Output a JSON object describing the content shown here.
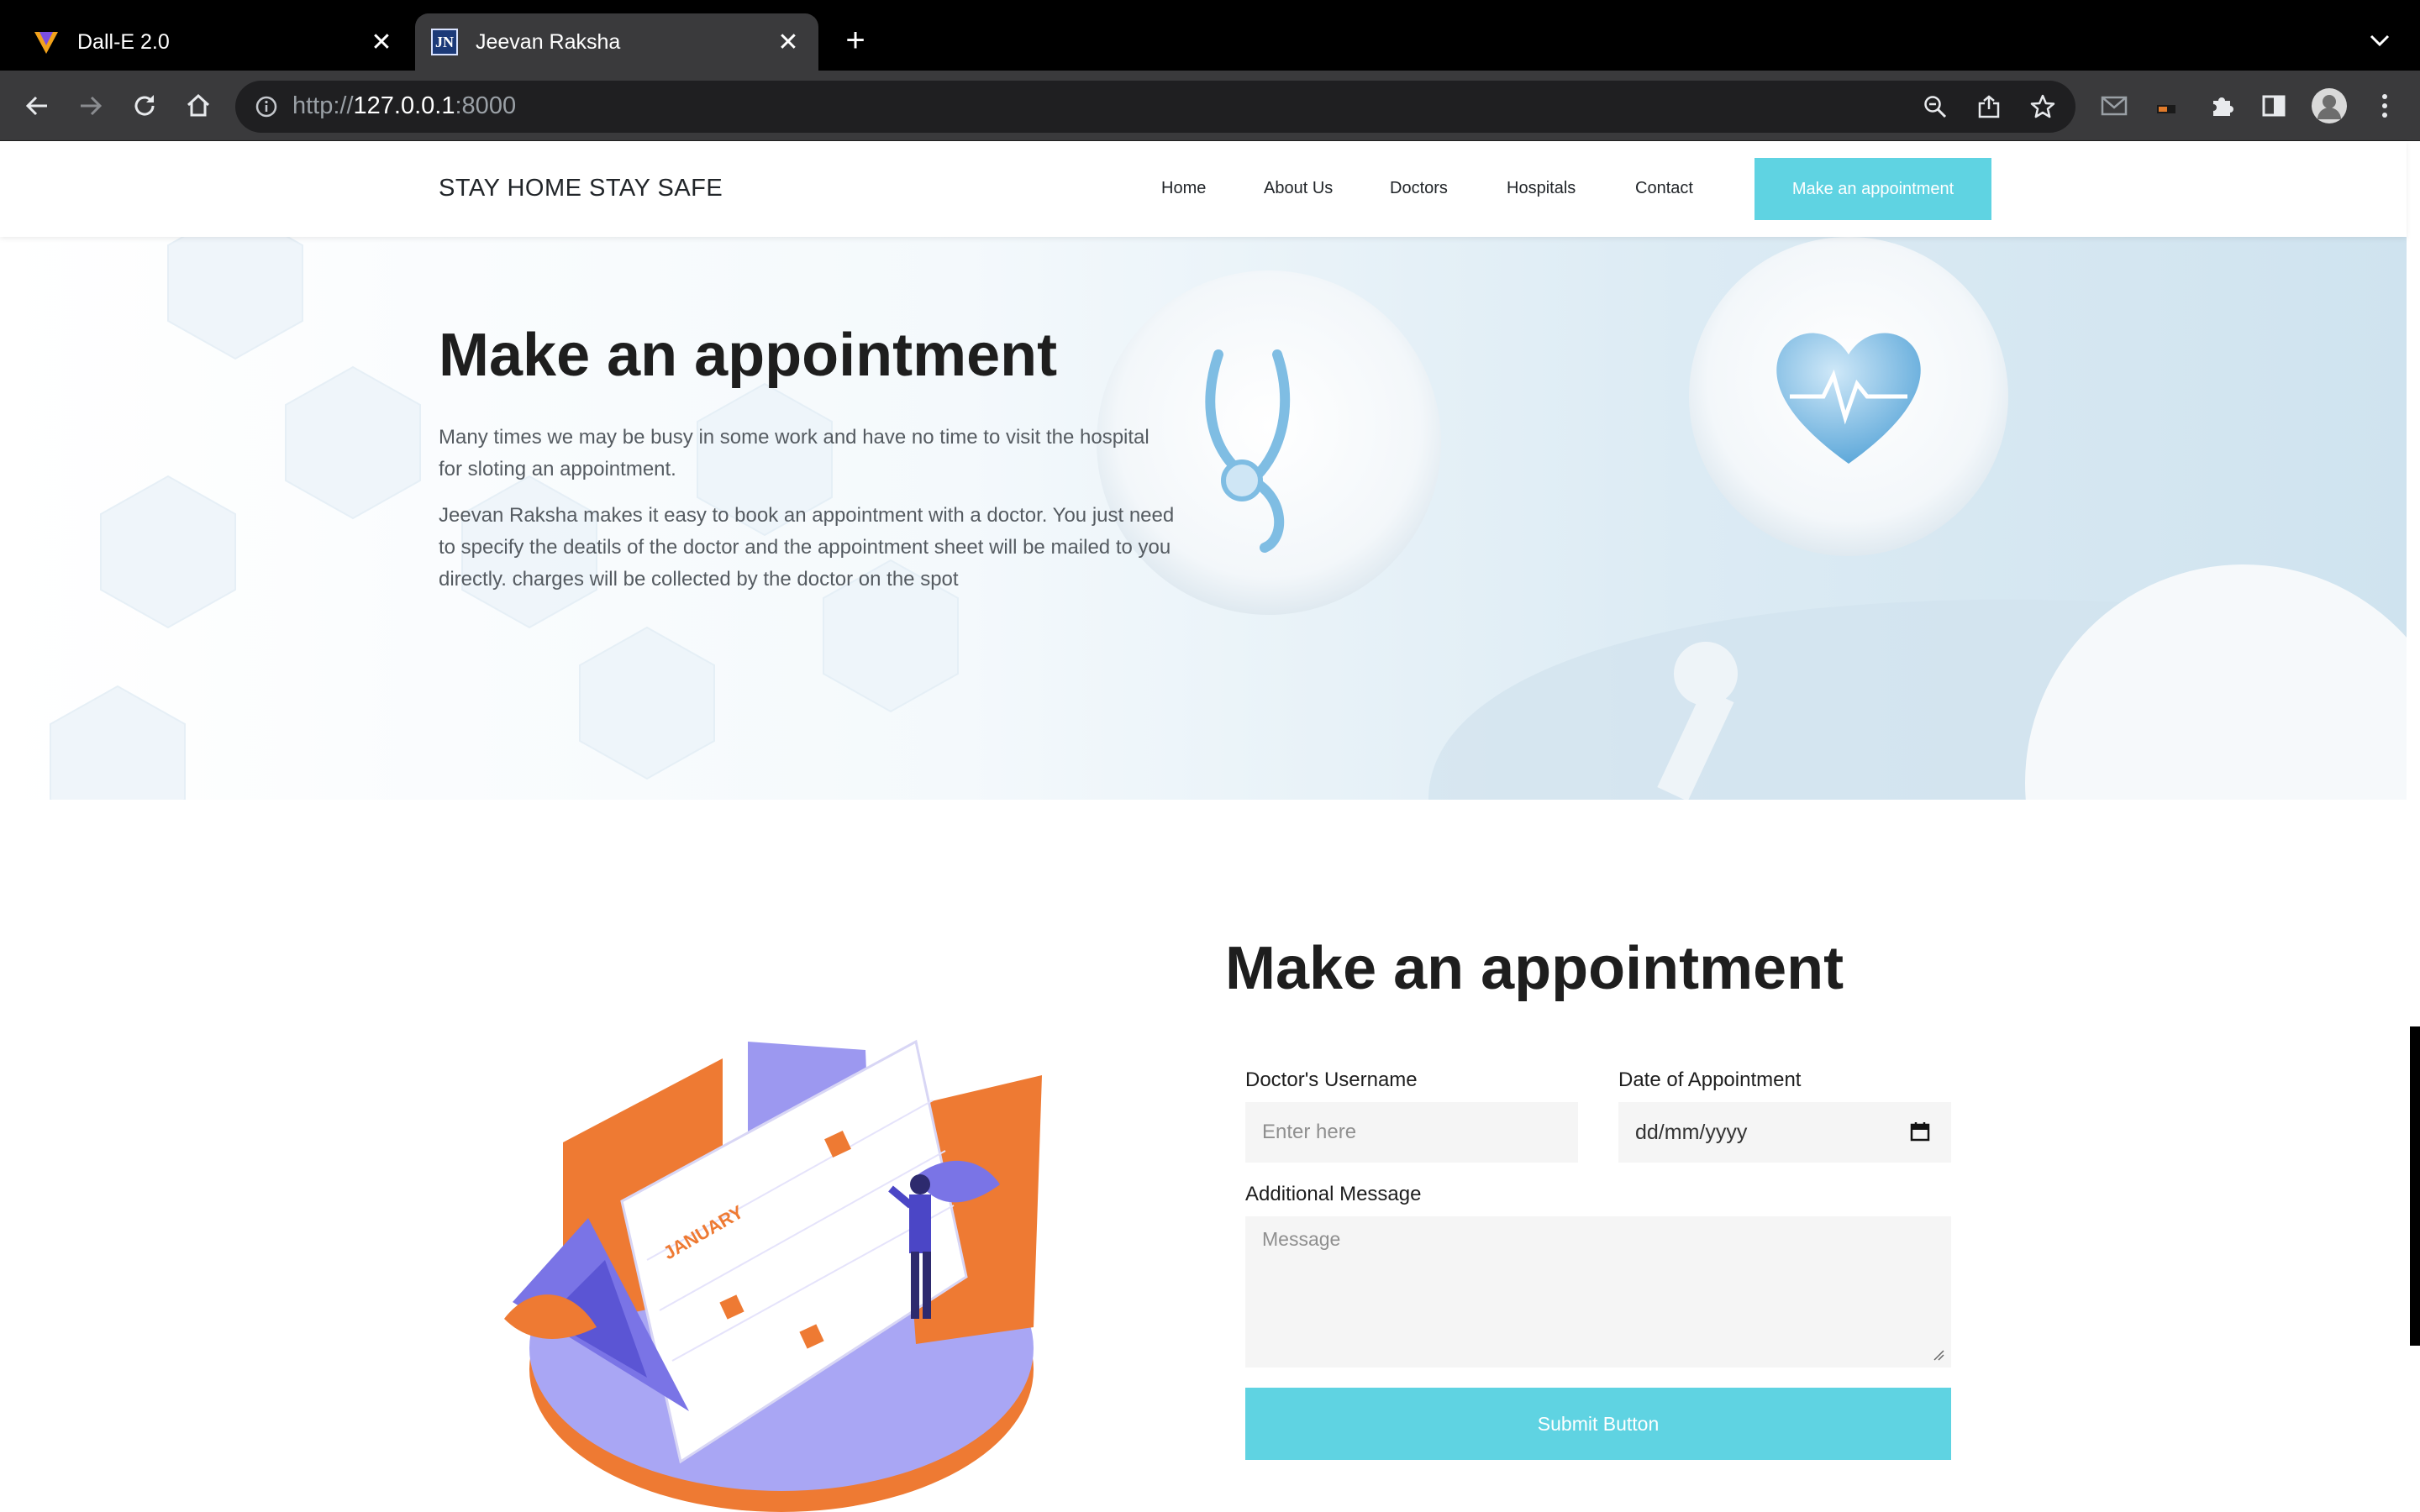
{
  "browser": {
    "tabs": [
      {
        "title": "Dall-E 2.0",
        "active": false,
        "icon": "dalle-favicon"
      },
      {
        "title": "Jeevan Raksha",
        "active": true,
        "icon": "jn-favicon",
        "icon_text": "JN"
      }
    ],
    "new_tab_label": "+",
    "url_scheme": "http://",
    "url_host": "127.0.0.1",
    "url_port": ":8000"
  },
  "nav": {
    "brand": "STAY HOME STAY SAFE",
    "links": [
      "Home",
      "About Us",
      "Doctors",
      "Hospitals",
      "Contact"
    ],
    "cta": "Make an appointment"
  },
  "hero": {
    "title": "Make an appointment",
    "paragraph1": "Many times we may be busy in some work and have no time to visit the hospital for sloting an appointment.",
    "paragraph2": "Jeevan Raksha makes it easy to book an appointment with a doctor. You just need to specify the deatils of the doctor and the appointment sheet will be mailed to you directly. charges will be collected by the doctor on the spot"
  },
  "form": {
    "title": "Make an appointment",
    "doctor_label": "Doctor's Username",
    "doctor_placeholder": "Enter here",
    "date_label": "Date of Appointment",
    "date_placeholder": "dd/mm/yyyy",
    "message_label": "Additional Message",
    "message_placeholder": "Message",
    "submit": "Submit Button"
  },
  "illustration": {
    "month": "JANUARY"
  },
  "colors": {
    "accent": "#5fd3e2",
    "calendar_orange": "#ee7a33",
    "calendar_purple": "#8c86ea"
  }
}
